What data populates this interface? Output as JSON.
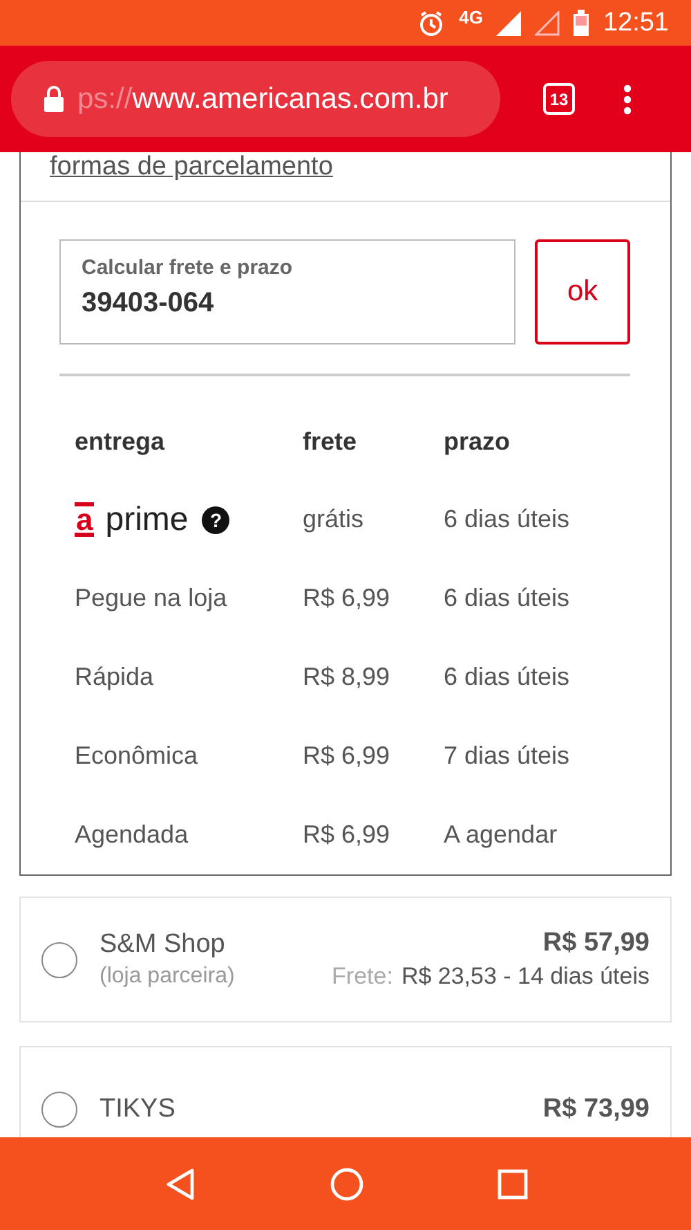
{
  "status_bar": {
    "network": "4G",
    "time": "12:51"
  },
  "browser": {
    "url_scheme": "ps://",
    "url_host": "www.americanas.com.br",
    "tab_count": "13"
  },
  "installments_link": "formas de parcelamento",
  "freight": {
    "label": "Calcular frete e prazo",
    "value": "39403-064",
    "button": "ok"
  },
  "shipping_table": {
    "columns": [
      "entrega",
      "frete",
      "prazo"
    ],
    "rows": [
      {
        "kind": "prime",
        "logo_letter": "a",
        "entrega": "prime",
        "help": "?",
        "frete": "grátis",
        "prazo": "6 dias úteis"
      },
      {
        "kind": "text",
        "entrega": "Pegue na loja",
        "frete": "R$ 6,99",
        "prazo": "6 dias úteis"
      },
      {
        "kind": "text",
        "entrega": "Rápida",
        "frete": "R$ 8,99",
        "prazo": "6 dias úteis"
      },
      {
        "kind": "text",
        "entrega": "Econômica",
        "frete": "R$ 6,99",
        "prazo": "7 dias úteis"
      },
      {
        "kind": "text",
        "entrega": "Agendada",
        "frete": "R$ 6,99",
        "prazo": "A agendar"
      }
    ]
  },
  "sellers": [
    {
      "name": "S&M Shop",
      "note": "(loja parceira)",
      "price": "R$ 57,99",
      "shipping_label": "Frete:",
      "shipping": "R$ 23,53 - 14 dias úteis",
      "selected": false
    },
    {
      "name": "TIKYS",
      "price": "R$ 73,99",
      "selected": false
    }
  ]
}
